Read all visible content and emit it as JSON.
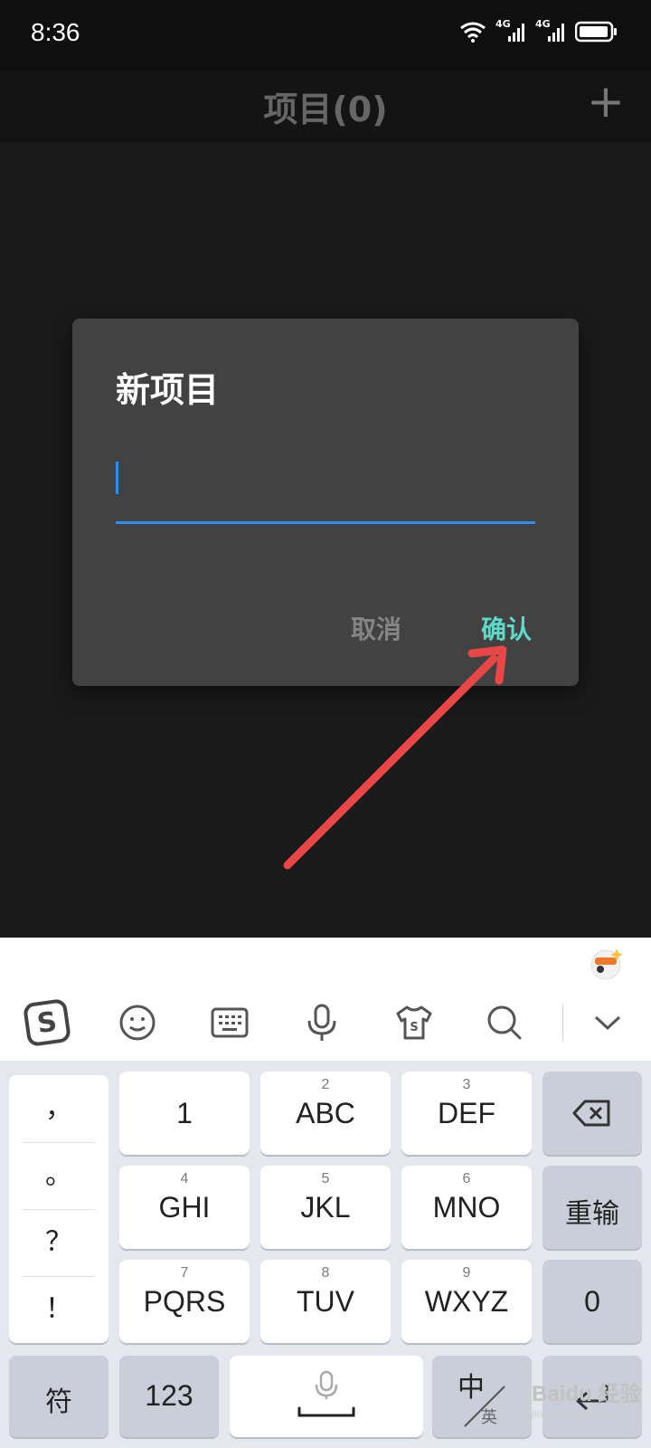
{
  "status_bar": {
    "time": "8:36",
    "network_1": "4G",
    "network_2": "4G"
  },
  "app_bar": {
    "title": "项目(0)",
    "add_icon": "plus-icon"
  },
  "dialog": {
    "title": "新项目",
    "input_value": "",
    "cancel_label": "取消",
    "confirm_label": "确认"
  },
  "keyboard": {
    "toolbar_icons": [
      "sogou-logo-icon",
      "emoji-icon",
      "keyboard-icon",
      "microphone-icon",
      "skin-icon",
      "search-icon",
      "collapse-icon"
    ],
    "punctuation": [
      "，",
      "。",
      "？",
      "！"
    ],
    "keys": {
      "k1": {
        "num": "",
        "label": "1"
      },
      "k2": {
        "num": "2",
        "label": "ABC"
      },
      "k3": {
        "num": "3",
        "label": "DEF"
      },
      "k4": {
        "num": "4",
        "label": "GHI"
      },
      "k5": {
        "num": "5",
        "label": "JKL"
      },
      "k6": {
        "num": "6",
        "label": "MNO"
      },
      "k7": {
        "num": "7",
        "label": "PQRS"
      },
      "k8": {
        "num": "8",
        "label": "TUV"
      },
      "k9": {
        "num": "9",
        "label": "WXYZ"
      }
    },
    "reset_label": "重输",
    "zero_label": "0",
    "symbol_label": "符",
    "num_label": "123",
    "zh_label": "中",
    "en_label": "英"
  },
  "watermark": {
    "brand": "Baidu 经验",
    "url": "jingyan.baidu.com"
  },
  "colors": {
    "accent_blue": "#2d8ef0",
    "confirm_teal": "#5fd9c8",
    "arrow_red": "#e94646"
  }
}
